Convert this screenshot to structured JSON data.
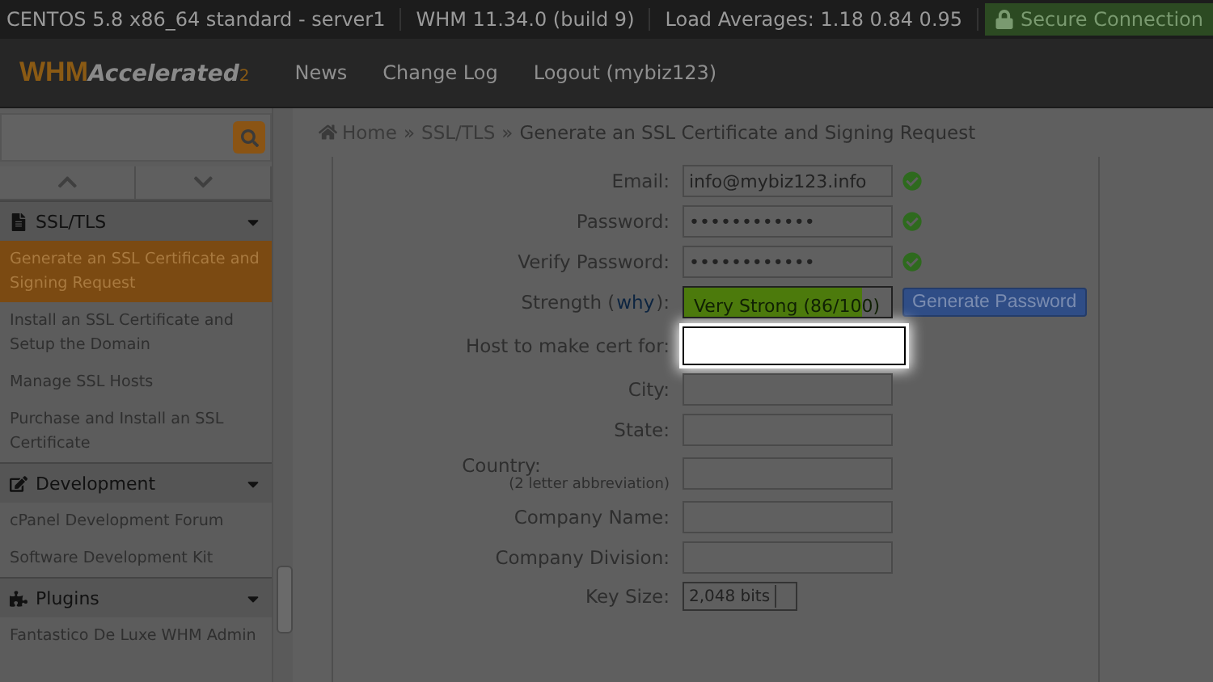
{
  "status_bar": {
    "items": [
      "CENTOS 5.8 x86_64 standard - server1",
      "WHM 11.34.0 (build 9)",
      "Load Averages: 1.18 0.84 0.95"
    ],
    "secure": "Secure Connection"
  },
  "header": {
    "logo_main": "WHM",
    "logo_sub": "Accelerated",
    "logo_num": "2",
    "nav": [
      "News",
      "Change Log",
      "Logout (mybiz123)"
    ]
  },
  "breadcrumb": {
    "separator": "»",
    "items": [
      "Home",
      "SSL/TLS",
      "Generate an SSL Certificate and Signing Request"
    ]
  },
  "sidebar": {
    "items": [
      {
        "kind": "section",
        "label": "SSL/TLS"
      },
      {
        "kind": "link",
        "label": "Generate an SSL Certificate and Signing Request",
        "selected": true
      },
      {
        "kind": "link",
        "label": "Install an SSL Certificate and Setup the Domain",
        "selected": false
      },
      {
        "kind": "link",
        "label": "Manage SSL Hosts",
        "selected": false
      },
      {
        "kind": "link",
        "label": "Purchase and Install an SSL Certificate",
        "selected": false
      },
      {
        "kind": "section",
        "label": "Development"
      },
      {
        "kind": "link",
        "label": "cPanel Development Forum",
        "selected": false
      },
      {
        "kind": "link",
        "label": "Software Development Kit",
        "selected": false
      },
      {
        "kind": "section",
        "label": "Plugins"
      },
      {
        "kind": "link",
        "label": "Fantastico De Luxe WHM Admin",
        "selected": false
      }
    ]
  },
  "form": {
    "fields": [
      {
        "kind": "text",
        "label": "Email:",
        "value": "info@mybiz123.info",
        "valid": true,
        "focused": false
      },
      {
        "kind": "password",
        "label": "Password:",
        "value": "••••••••••••",
        "valid": true,
        "focused": false
      },
      {
        "kind": "password",
        "label": "Verify Password:",
        "value": "••••••••••••",
        "valid": true,
        "focused": false
      },
      {
        "kind": "strength",
        "label": "Strength (",
        "link": "why",
        "label_end": "):",
        "reading": "Very Strong (86/100)",
        "level": 0.86,
        "button": "Generate Password"
      },
      {
        "kind": "text",
        "label": "Host to make cert for:",
        "valid": false,
        "focused": true
      },
      {
        "kind": "text",
        "label": "City:",
        "valid": false,
        "focused": false
      },
      {
        "kind": "text",
        "label": "State:",
        "valid": false,
        "focused": false
      },
      {
        "kind": "text",
        "label": "Country:",
        "hint": "(2 letter abbreviation)",
        "valid": false,
        "focused": false
      },
      {
        "kind": "text",
        "label": "Company Name:",
        "valid": false,
        "focused": false
      },
      {
        "kind": "text",
        "label": "Company Division:",
        "valid": false,
        "focused": false
      },
      {
        "kind": "select",
        "label": "Key Size:",
        "value": "2,048 bits"
      }
    ]
  }
}
